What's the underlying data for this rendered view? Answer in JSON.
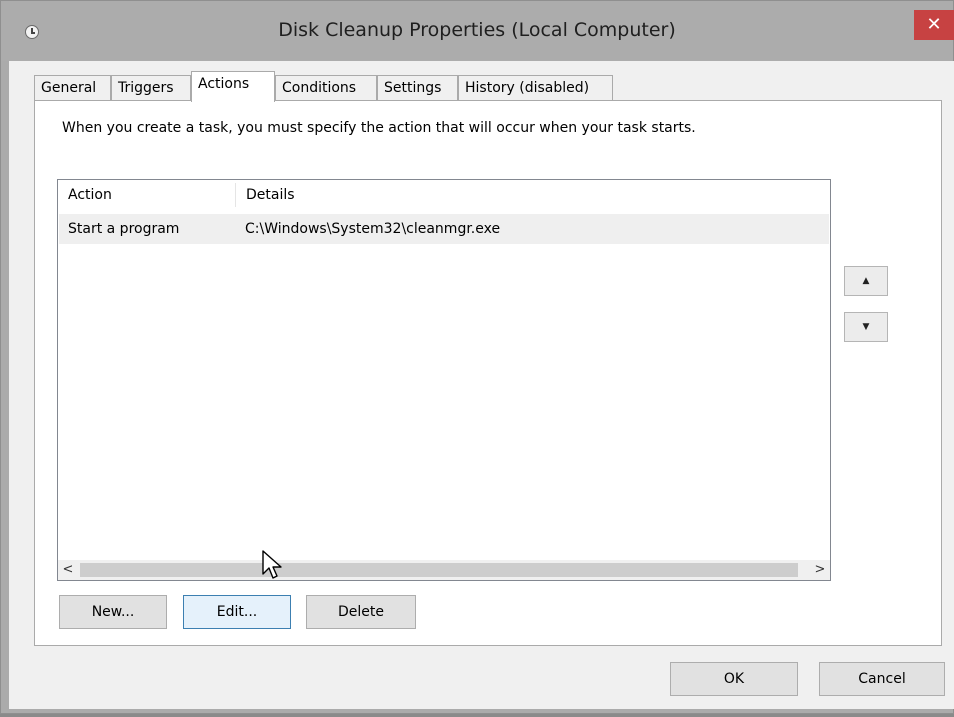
{
  "window": {
    "title": "Disk Cleanup Properties (Local Computer)",
    "close_glyph": "✕",
    "icon": "clock-icon"
  },
  "tabs": [
    {
      "label": "General",
      "active": false
    },
    {
      "label": "Triggers",
      "active": false
    },
    {
      "label": "Actions",
      "active": true
    },
    {
      "label": "Conditions",
      "active": false
    },
    {
      "label": "Settings",
      "active": false
    },
    {
      "label": "History (disabled)",
      "active": false
    }
  ],
  "actions_tab": {
    "instruction": "When you create a task, you must specify the action that will occur when your task starts.",
    "columns": [
      "Action",
      "Details"
    ],
    "rows": [
      {
        "action": "Start a program",
        "details": "C:\\Windows\\System32\\cleanmgr.exe"
      }
    ],
    "scroll_left": "<",
    "scroll_right": ">",
    "move_up_glyph": "▲",
    "move_down_glyph": "▼",
    "buttons": {
      "new": "New...",
      "edit": "Edit...",
      "delete": "Delete"
    }
  },
  "footer": {
    "ok": "OK",
    "cancel": "Cancel"
  },
  "colors": {
    "close_button": "#c74242",
    "selected_row": "#e5f3fb",
    "focused_button_border": "#3c7fb1"
  }
}
